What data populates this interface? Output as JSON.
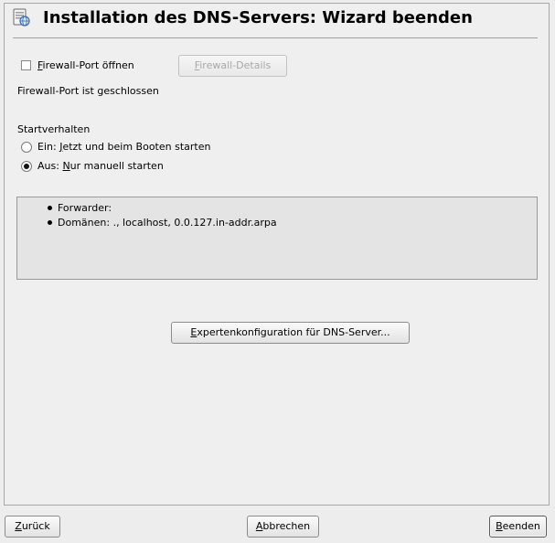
{
  "window": {
    "title": "Installation des DNS-Servers: Wizard beenden",
    "icon": "dns-server-icon"
  },
  "firewall": {
    "checkbox_label_mnemonic": "F",
    "checkbox_label_rest": "irewall-Port öffnen",
    "checkbox_checked": false,
    "details_button_mnemonic": "F",
    "details_button_rest": "irewall-Details",
    "details_button_enabled": false,
    "status_text": "Firewall-Port ist geschlossen"
  },
  "startup": {
    "heading": "Startverhalten",
    "options": [
      {
        "label_prefix": "Ein: ",
        "mnemonic": "J",
        "label_rest": "etzt und beim Booten starten",
        "selected": false
      },
      {
        "label_prefix": "Aus: ",
        "mnemonic": "N",
        "label_rest": "ur manuell starten",
        "selected": true
      }
    ]
  },
  "summary": {
    "items": [
      "Forwarder:",
      "Domänen: ., localhost, 0.0.127.in-addr.arpa"
    ]
  },
  "expert_button": {
    "mnemonic": "E",
    "label_rest": "xpertenkonfiguration für DNS-Server..."
  },
  "buttons": {
    "back_mnemonic": "Z",
    "back_rest": "urück",
    "abort_mnemonic": "A",
    "abort_rest": "bbrechen",
    "finish_mnemonic": "B",
    "finish_rest": "eenden"
  }
}
